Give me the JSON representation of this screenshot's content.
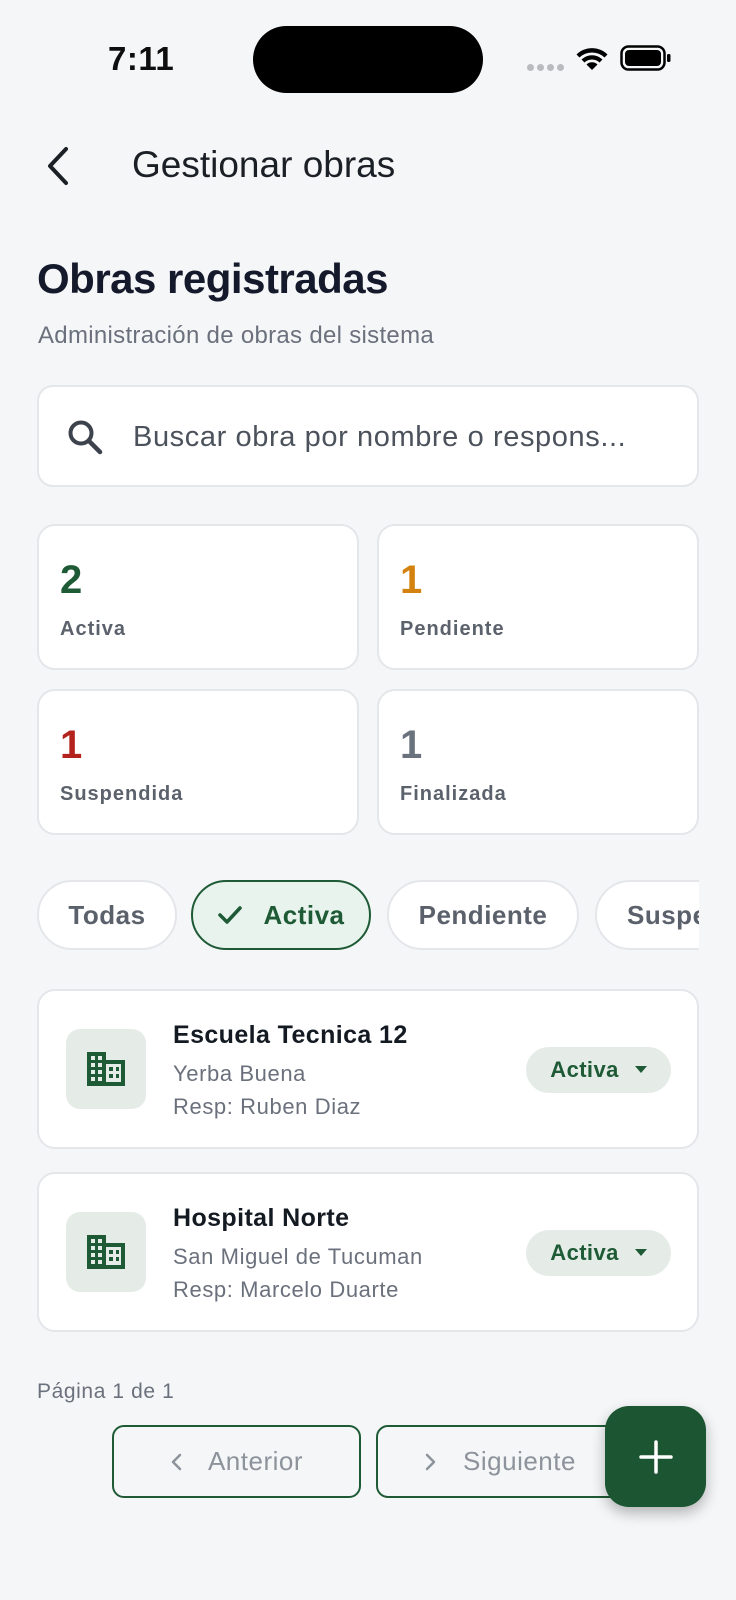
{
  "status_bar": {
    "time": "7:11"
  },
  "header": {
    "title": "Gestionar obras"
  },
  "main": {
    "title": "Obras registradas",
    "subtitle": "Administración de obras del sistema"
  },
  "search": {
    "placeholder": "Buscar obra por nombre o respons..."
  },
  "stats": [
    {
      "value": "2",
      "label": "Activa",
      "color": "#1e5a35"
    },
    {
      "value": "1",
      "label": "Pendiente",
      "color": "#d4820f"
    },
    {
      "value": "1",
      "label": "Suspendida",
      "color": "#b3221c"
    },
    {
      "value": "1",
      "label": "Finalizada",
      "color": "#6a727d"
    }
  ],
  "filters": [
    {
      "label": "Todas",
      "selected": false
    },
    {
      "label": "Activa",
      "selected": true
    },
    {
      "label": "Pendiente",
      "selected": false
    },
    {
      "label": "Suspendida",
      "selected": false
    }
  ],
  "obras": [
    {
      "name": "Escuela Tecnica 12",
      "city": "Yerba Buena",
      "resp": "Resp: Ruben Diaz",
      "status": "Activa",
      "icon": "building-icon"
    },
    {
      "name": "Hospital Norte",
      "city": "San Miguel de Tucuman",
      "resp": "Resp: Marcelo Duarte",
      "status": "Activa",
      "icon": "building-icon"
    }
  ],
  "pagination": {
    "info": "Página 1 de 1",
    "prev_label": "Anterior",
    "next_label": "Siguiente"
  },
  "colors": {
    "primary": "#1e5a35",
    "background": "#f5f6f8",
    "pending": "#d4820f",
    "suspended": "#b3221c",
    "finished": "#6a727d"
  }
}
